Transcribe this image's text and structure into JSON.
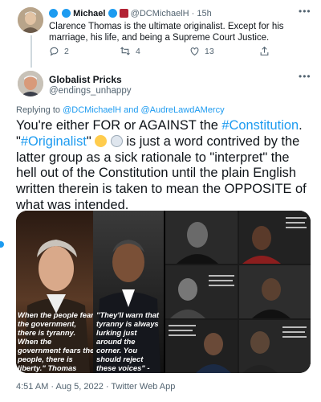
{
  "parent_tweet": {
    "display_name": "Michael",
    "handle": "@DCMichaelH",
    "separator": "·",
    "age": "15h",
    "text": "Clarence Thomas is the ultimate originalist.  Except for his marriage, his life, and being a Supreme Court Justice.",
    "actions": {
      "replies": "2",
      "retweets": "4",
      "likes": "13"
    }
  },
  "main_tweet": {
    "display_name": "Globalist Pricks",
    "handle": "@endings_unhappy",
    "replying_prefix": "Replying to",
    "replying_users": [
      "@DCMichaelH",
      "and",
      "@AudreLawdAMercy"
    ],
    "text_parts": {
      "p1": "You're either FOR or AGAINST the ",
      "hashtag1": "#Constitution",
      "p2": ". \"",
      "hashtag2": "#Originalist",
      "p3": "\" ",
      "p4": " is just a word contrived by the latter group as a sick rationale to \"interpret\" the hell out of the Constitution until the plain English written therein is taken to mean the OPPOSITE of what was intended."
    },
    "images": {
      "jefferson_quote": "When the people fear the government, there is tyranny. When the government fears the people, there is liberty.\" Thomas Jefferson",
      "obama_quote": "\"They'll warn that tyranny is always lurking just around the corner. You should reject these voices\" -Barack Obama"
    },
    "timestamp": "4:51 AM · Aug 5, 2022 · Twitter Web App"
  },
  "colors": {
    "link": "#1d9bf0",
    "muted": "#536471",
    "text": "#0f1419"
  }
}
